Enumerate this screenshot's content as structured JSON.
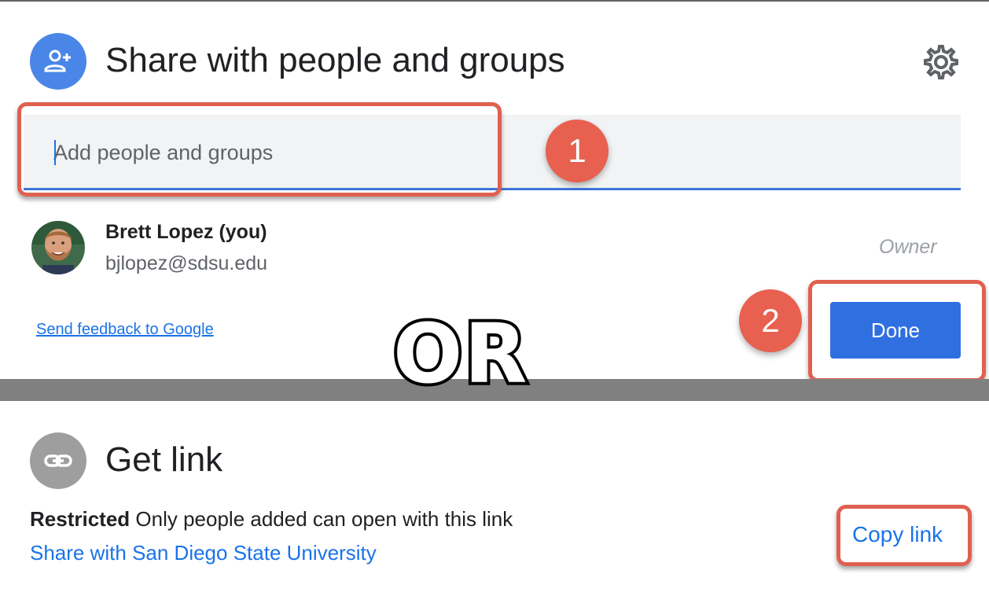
{
  "share_section": {
    "title": "Share with people and groups",
    "search_placeholder": "Add people and groups",
    "user": {
      "name": "Brett Lopez (you)",
      "email": "bjlopez@sdsu.edu",
      "role": "Owner"
    },
    "feedback_link": "Send feedback to Google",
    "done_label": "Done"
  },
  "link_section": {
    "title": "Get link",
    "restriction_label": "Restricted",
    "restriction_desc": "Only people added can open with this link",
    "share_domain_link": "Share with San Diego State University",
    "copy_link_label": "Copy link"
  },
  "annotations": {
    "badge_1": "1",
    "badge_2": "2",
    "or_text": "OR"
  },
  "colors": {
    "accent_blue": "#1a73e8",
    "done_button": "#2f6fe0",
    "highlight_red": "#e06050",
    "share_icon_bg": "#4a86e8",
    "link_icon_bg": "#9e9e9e"
  },
  "icons": {
    "share": "person-add-icon",
    "settings": "gear-icon",
    "link": "link-icon"
  }
}
